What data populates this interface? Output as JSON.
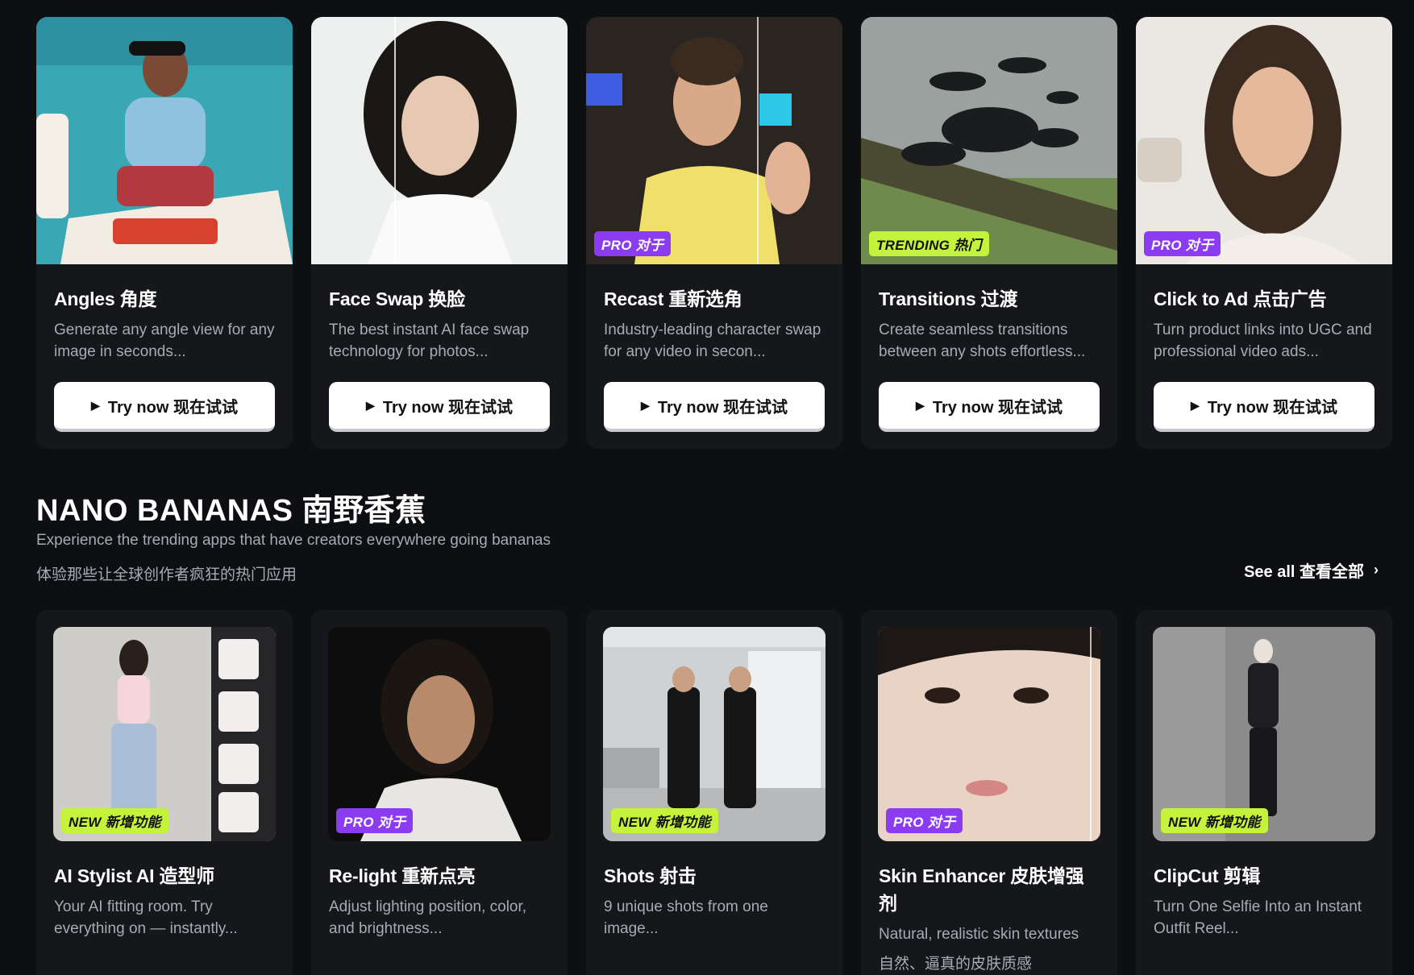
{
  "cta": {
    "try_label": "Try now  现在试试"
  },
  "top_cards": [
    {
      "title": "Angles  角度",
      "desc": "Generate any angle view for any image in seconds...",
      "badge": ""
    },
    {
      "title": "Face Swap  换脸",
      "desc": "The best instant AI face swap technology for photos...",
      "badge": ""
    },
    {
      "title": "Recast  重新选角",
      "desc": "Industry-leading character swap for any video in secon...",
      "badge": "PRO  对于"
    },
    {
      "title": "Transitions  过渡",
      "desc": "Create seamless transitions between any shots effortless...",
      "badge": "TRENDING  热门"
    },
    {
      "title": "Click to Ad  点击广告",
      "desc": "Turn product links into UGC and professional video ads...",
      "badge": "PRO  对于"
    }
  ],
  "section": {
    "title": "NANO BANANAS  南野香蕉",
    "subtitle": "Experience the trending apps that have creators everywhere going bananas",
    "subtitle_cn": "体验那些让全球创作者疯狂的热门应用",
    "see_all": "See all  查看全部",
    "see_all_icon": "chevron-right-icon"
  },
  "bottom_cards": [
    {
      "title": "AI Stylist  AI 造型师",
      "desc": "Your AI fitting room. Try everything on — instantly...",
      "desc_cn": "",
      "badge": "NEW  新增功能"
    },
    {
      "title": "Re-light  重新点亮",
      "desc": "Adjust lighting position, color, and brightness...",
      "desc_cn": "",
      "badge": "PRO  对于"
    },
    {
      "title": "Shots  射击",
      "desc": "9 unique shots from one image...",
      "desc_cn": "",
      "badge": "NEW  新增功能"
    },
    {
      "title": "Skin Enhancer  皮肤增强剂",
      "desc": "Natural, realistic skin textures",
      "desc_cn": "自然、逼真的皮肤质感",
      "badge": "PRO  对于"
    },
    {
      "title": "ClipCut  剪辑",
      "desc": "Turn One Selfie Into an Instant Outfit Reel...",
      "desc_cn": "",
      "badge": "NEW  新增功能"
    }
  ],
  "colors": {
    "background": "#0e0f12",
    "card": "#16171b",
    "pro_badge": "#8b3cf0",
    "new_badge": "#c5f23a",
    "muted_text": "#a8abb3"
  }
}
